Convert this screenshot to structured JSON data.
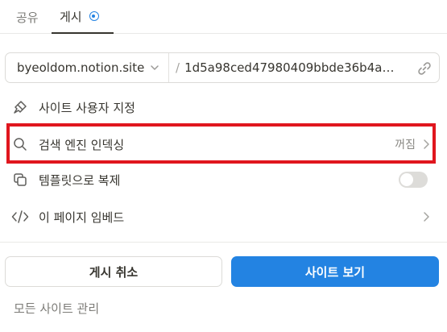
{
  "tabs": {
    "share_label": "공유",
    "publish_label": "게시"
  },
  "url": {
    "domain": "byeoldom.notion.site",
    "slash": "/",
    "path": "1d5a98ced47980409bbde36b4a1e..."
  },
  "options": {
    "customize_label": "사이트 사용자 지정",
    "indexing_label": "검색 엔진 인덱싱",
    "indexing_state": "꺼짐",
    "duplicate_label": "템플릿으로 복제",
    "embed_label": "이 페이지 임베드"
  },
  "actions": {
    "unpublish_label": "게시 취소",
    "view_site_label": "사이트 보기"
  },
  "footer": {
    "manage_label": "모든 사이트 관리"
  },
  "colors": {
    "accent": "#2383e2",
    "highlight": "#e0161e"
  },
  "state": {
    "duplicate_as_template": false
  }
}
